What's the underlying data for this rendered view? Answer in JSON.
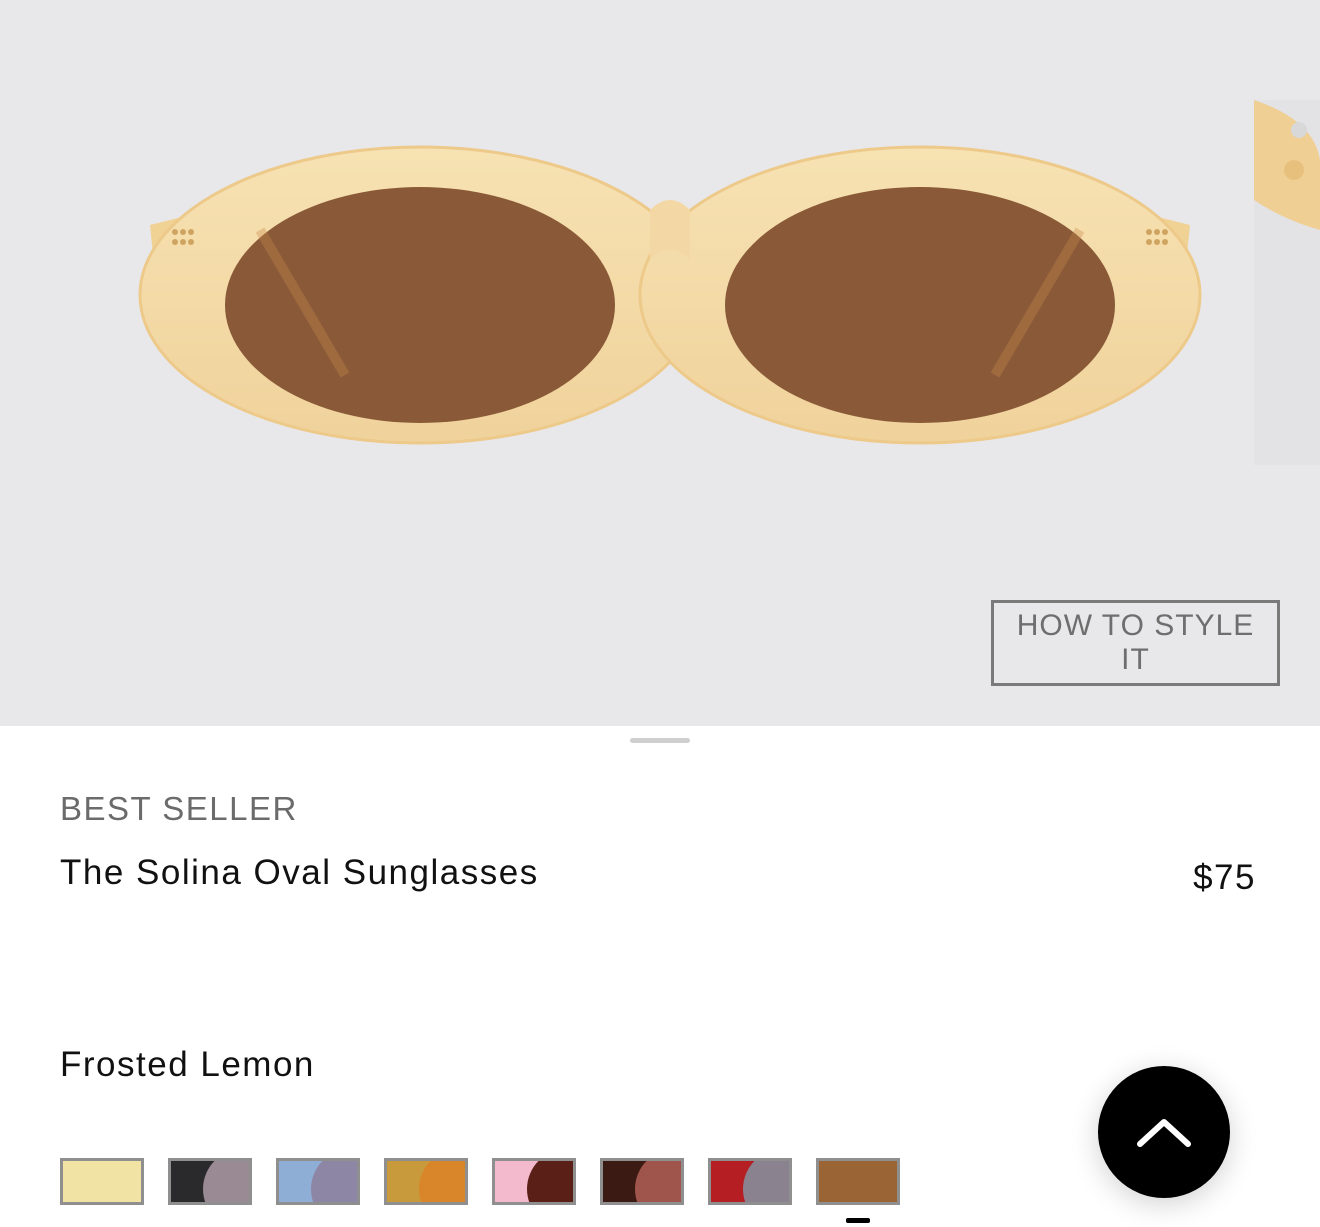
{
  "gallery": {
    "style_button_label": "HOW TO STYLE IT",
    "frame_color": "#f3d9a8",
    "lens_color": "#8a5a38"
  },
  "product": {
    "badge": "BEST SELLER",
    "name": "The Solina Oval Sunglasses",
    "price": "$75",
    "selected_color": "Frosted Lemon"
  },
  "swatches": [
    {
      "name": "frosted-lemon",
      "colors": [
        "#f1e3a3"
      ]
    },
    {
      "name": "black-grey",
      "colors": [
        "#2a2a2c",
        "#9a8a94"
      ]
    },
    {
      "name": "blue-grey",
      "colors": [
        "#8eaed6",
        "#8d86a4"
      ]
    },
    {
      "name": "amber",
      "colors": [
        "#c99a3c",
        "#d9862a"
      ]
    },
    {
      "name": "pink-tortoise",
      "colors": [
        "#f3b9cc",
        "#5a1f16"
      ]
    },
    {
      "name": "tortoise-rose",
      "colors": [
        "#3a1a12",
        "#a0554c"
      ]
    },
    {
      "name": "red-grey",
      "colors": [
        "#b51f24",
        "#8b8290"
      ]
    },
    {
      "name": "caramel",
      "colors": [
        "#9a6434"
      ]
    }
  ],
  "scroll_top": {
    "icon": "chevron-up-icon"
  }
}
